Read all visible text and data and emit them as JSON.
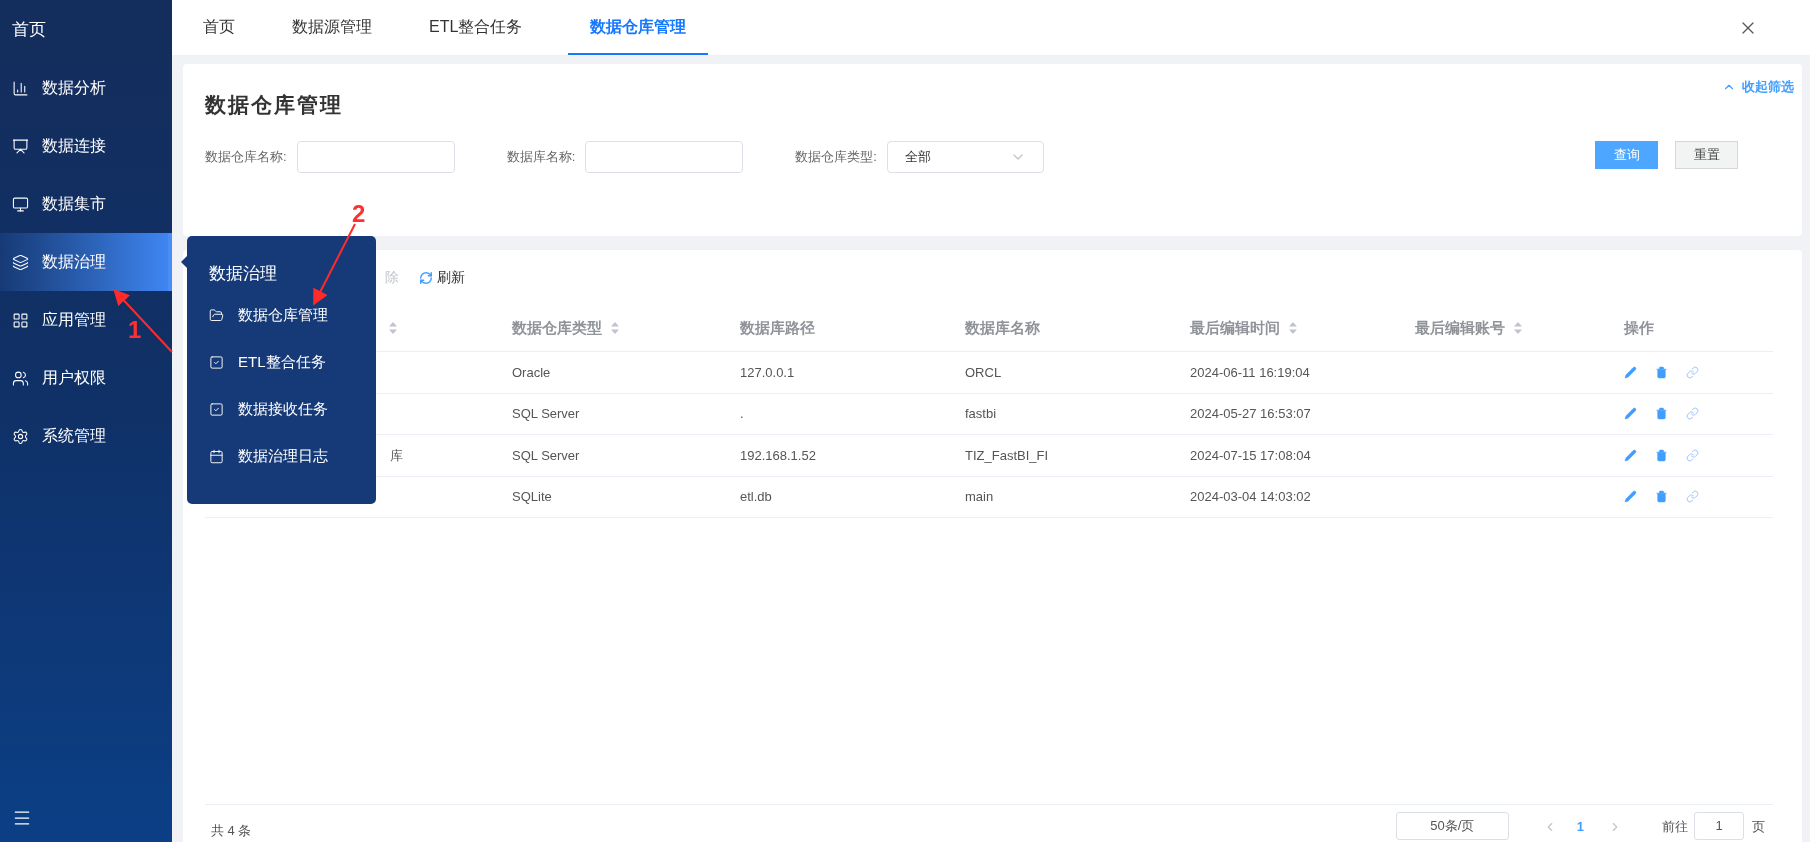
{
  "sidebar": {
    "home": "首页",
    "items": [
      {
        "label": "数据分析",
        "selected": false
      },
      {
        "label": "数据连接",
        "selected": false
      },
      {
        "label": "数据集市",
        "selected": false
      },
      {
        "label": "数据治理",
        "selected": true
      },
      {
        "label": "应用管理",
        "selected": false
      },
      {
        "label": "用户权限",
        "selected": false
      },
      {
        "label": "系统管理",
        "selected": false
      }
    ]
  },
  "flyout": {
    "title": "数据治理",
    "items": [
      {
        "label": "数据仓库管理"
      },
      {
        "label": "ETL整合任务"
      },
      {
        "label": "数据接收任务"
      },
      {
        "label": "数据治理日志"
      }
    ]
  },
  "tabs": [
    {
      "label": "首页",
      "selected": false
    },
    {
      "label": "数据源管理",
      "selected": false
    },
    {
      "label": "ETL整合任务",
      "selected": false
    },
    {
      "label": "数据仓库管理",
      "selected": true
    }
  ],
  "filter": {
    "title": "数据仓库管理",
    "collapse": "收起筛选",
    "fields": [
      {
        "kind": "input",
        "label": "数据仓库名称:"
      },
      {
        "kind": "input",
        "label": "数据库名称:"
      },
      {
        "kind": "select",
        "label": "数据仓库类型:",
        "value": "全部"
      }
    ],
    "buttons": [
      {
        "kind": "primary",
        "label": "查询"
      },
      {
        "kind": "default",
        "label": "重置"
      }
    ]
  },
  "toolbar": [
    {
      "kind": "delete",
      "label": "除",
      "disabled": true
    },
    {
      "kind": "refresh",
      "label": "刷新",
      "disabled": false
    }
  ],
  "table": {
    "columns": [
      {
        "sortable": true
      },
      {
        "label": "数据仓库类型",
        "sortable": true
      },
      {
        "label": "数据库路径",
        "sortable": false
      },
      {
        "label": "数据库名称",
        "sortable": false
      },
      {
        "label": "最后编辑时间",
        "sortable": true
      },
      {
        "label": "最后编辑账号",
        "sortable": true
      },
      {
        "label": "操作",
        "sortable": false
      }
    ],
    "rows": [
      {
        "type": "Oracle",
        "path": "127.0.0.1",
        "db_name": "ORCL",
        "edited_at": "2024-06-11 16:19:04"
      },
      {
        "type": "SQL Server",
        "path": ".",
        "db_name": "fastbi",
        "edited_at": "2024-05-27 16:53:07"
      },
      {
        "column_1": "库",
        "type": "SQL Server",
        "path": "192.168.1.52",
        "db_name": "TIZ_FastBI_FI",
        "edited_at": "2024-07-15 17:08:04"
      },
      {
        "type": "SQLite",
        "path": "etl.db",
        "db_name": "main",
        "edited_at": "2024-03-04 14:03:02"
      }
    ]
  },
  "footer": {
    "total": "共 4 条",
    "page_size": "50条/页",
    "current_page": "1",
    "goto_label": "前往",
    "goto_value": "1",
    "page_suffix": "页"
  },
  "annotations": [
    {
      "label": "1"
    },
    {
      "label": "2"
    }
  ]
}
